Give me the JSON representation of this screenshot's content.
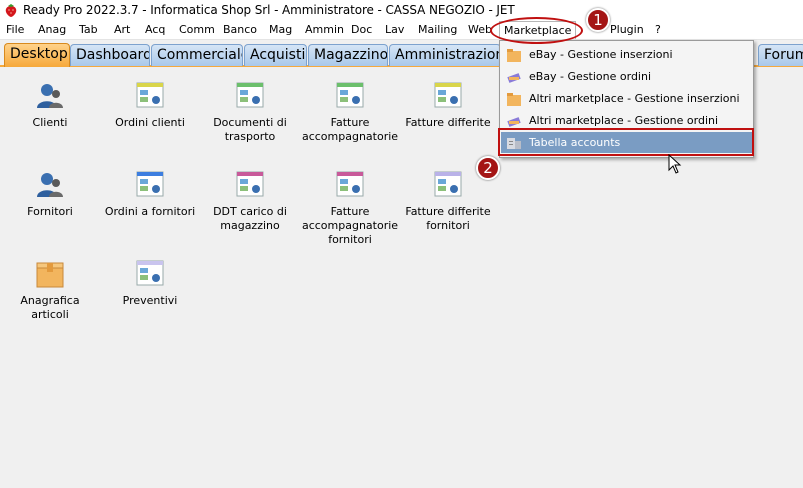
{
  "window": {
    "title": "Ready Pro 2022.3.7 - Informatica Shop Srl - Amministratore - CASSA NEGOZIO - JET"
  },
  "menu": {
    "items": [
      "File",
      "Anag",
      "Tab",
      "Art",
      "Acq",
      "Comm",
      "Banco",
      "Mag",
      "Ammin",
      "Doc",
      "Lav",
      "Mailing",
      "Web",
      "Marketplace",
      "Plugin",
      "?"
    ]
  },
  "tabs": [
    "Desktop",
    "Dashboard",
    "Commerciale",
    "Acquisti",
    "Magazzino",
    "Amministrazione",
    "Forum"
  ],
  "desktop": {
    "row1": [
      "Clienti",
      "Ordini clienti",
      "Documenti di trasporto",
      "Fatture accompagnatorie",
      "Fatture differite"
    ],
    "row2": [
      "Fornitori",
      "Ordini a fornitori",
      "DDT carico di magazzino",
      "Fatture accompagnatorie fornitori",
      "Fatture differite fornitori"
    ],
    "row3": [
      "Anagrafica articoli",
      "Preventivi"
    ]
  },
  "dropdown": {
    "items": [
      "eBay - Gestione inserzioni",
      "eBay - Gestione ordini",
      "Altri marketplace - Gestione inserzioni",
      "Altri marketplace - Gestione ordini",
      "Tabella accounts"
    ],
    "highlighted_index": 4
  },
  "callouts": [
    "1",
    "2"
  ],
  "colors": {
    "accent_tab": "#f6a83a",
    "tab_blue": "#a9c8ea",
    "highlight": "#7a9cc3",
    "callout_red": "#c01010"
  }
}
